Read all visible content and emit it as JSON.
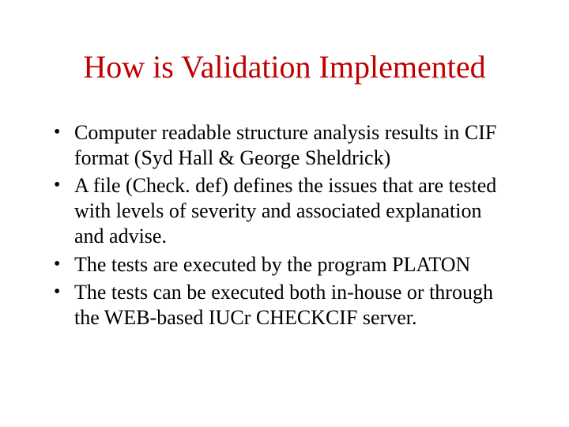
{
  "title": "How is Validation Implemented",
  "bullets": [
    "Computer readable structure analysis results in CIF format  (Syd Hall & George Sheldrick)",
    "A file (Check. def) defines the issues that are tested with levels of severity and associated explanation and advise.",
    "The tests are executed by the program PLATON",
    "The tests can be executed both in-house or through the WEB-based IUCr CHECKCIF server."
  ]
}
